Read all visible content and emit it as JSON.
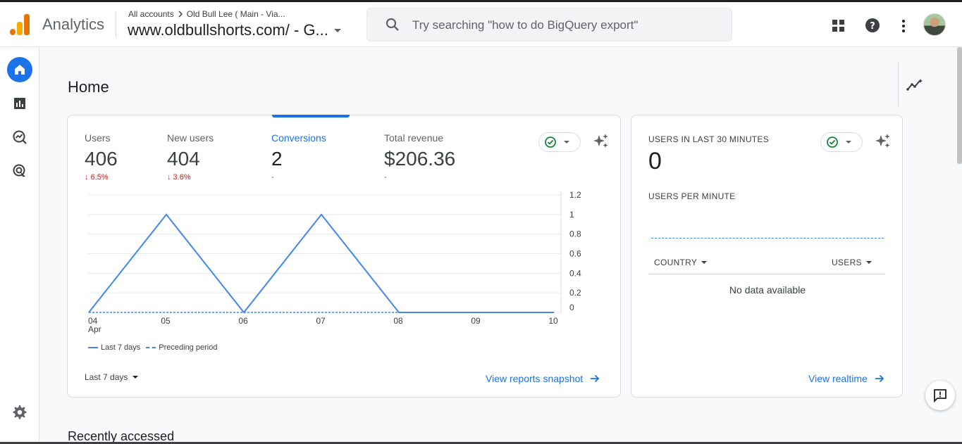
{
  "app": {
    "name": "Analytics"
  },
  "header": {
    "breadcrumb_root": "All accounts",
    "breadcrumb_account": "Old Bull Lee ( Main - Via...",
    "property": "www.oldbullshorts.com/ - G...",
    "search_placeholder": "Try searching \"how to do BigQuery export\""
  },
  "page": {
    "title": "Home",
    "recent_heading": "Recently accessed"
  },
  "metrics": [
    {
      "label": "Users",
      "value": "406",
      "delta": "↓ 6.5%"
    },
    {
      "label": "New users",
      "value": "404",
      "delta": "↓ 3.6%"
    },
    {
      "label": "Conversions",
      "value": "2",
      "delta": "-"
    },
    {
      "label": "Total revenue",
      "value": "$206.36",
      "delta": "-"
    }
  ],
  "chart_data": {
    "type": "line",
    "x": [
      "04",
      "05",
      "06",
      "07",
      "08",
      "09",
      "10"
    ],
    "x_sub": [
      "Apr",
      "",
      "",
      "",
      "",
      "",
      ""
    ],
    "yticks": [
      "1.2",
      "1",
      "0.8",
      "0.6",
      "0.4",
      "0.2",
      "0"
    ],
    "ylim": [
      0,
      1.2
    ],
    "series": [
      {
        "name": "Last 7 days",
        "values": [
          0,
          1,
          0,
          1,
          0,
          0,
          0
        ]
      },
      {
        "name": "Preceding period",
        "values": [
          0,
          0,
          0,
          0,
          0,
          0,
          0
        ]
      }
    ],
    "grid": true,
    "colors": {
      "line": "#4285f4"
    }
  },
  "card_main": {
    "date_range": "Last 7 days",
    "view_link": "View reports snapshot"
  },
  "realtime": {
    "title": "USERS IN LAST 30 MINUTES",
    "value": "0",
    "per_minute_label": "USERS PER MINUTE",
    "col_country": "COUNTRY",
    "col_users": "USERS",
    "empty": "No data available",
    "view_link": "View realtime"
  },
  "colors": {
    "accent": "#1a73e8",
    "negative": "#c5221f",
    "logo_orange": "#f9ab00",
    "logo_dark_orange": "#e37400"
  }
}
